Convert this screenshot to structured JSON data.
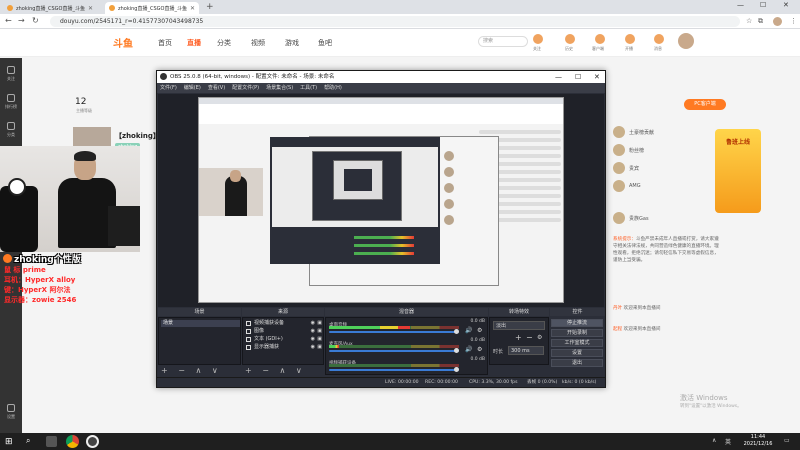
{
  "browser": {
    "tabs": [
      {
        "title": "zhoking直播_CSGO直播_斗鱼...",
        "active": false
      },
      {
        "title": "zhoking直播_CSGO直播_斗鱼...",
        "active": true
      }
    ],
    "new_tab": "+",
    "address": "douyu.com/2545171_r=0.41577307043498735",
    "window_controls": {
      "minimize": "—",
      "maximize": "☐",
      "close": "✕"
    }
  },
  "site": {
    "logo": "斗鱼",
    "nav": [
      "首页",
      "直播",
      "分类",
      "视频",
      "游戏",
      "鱼吧"
    ],
    "active_nav": "直播",
    "search_placeholder": "搜索",
    "header_icons": [
      {
        "label": "关注"
      },
      {
        "label": "历史"
      },
      {
        "label": "客户端"
      },
      {
        "label": "开播"
      },
      {
        "label": "消息"
      }
    ]
  },
  "room": {
    "fan_count": "12",
    "fan_label": "主播等级",
    "name": "【zhoking】",
    "tag": "zhoking",
    "left_nav": [
      "关注",
      "排行榜",
      "分类",
      "直播",
      "设置"
    ]
  },
  "overlay": {
    "name": "zhoking个性版",
    "lines": [
      "鼠 标 prime",
      "耳机：HyperX alloy",
      "键：HyperX 阿尔法",
      "显示器：zowie 2546"
    ]
  },
  "sidebar": {
    "rank_button": "PC客户端",
    "rows": [
      {
        "name": "土豪榜贡献"
      },
      {
        "name": "粉丝榜"
      },
      {
        "name": "贵宾"
      },
      {
        "name": "AMG"
      },
      {
        "name": "贵族Gas"
      }
    ],
    "banner_text": "鲁班上线",
    "notice_label": "系统提示：",
    "notice_body": "斗鱼严禁未成年人直播或打赏，请大家遵守相关法律法规，共同营造绿色健康的直播环境。理性观看，拒绝沉迷；请勿轻信私下交易等虚假信息，谨防上当受骗。",
    "messages": [
      {
        "user": "丹叶",
        "text": "欢迎来到本直播间"
      },
      {
        "user": "起程",
        "text": "欢迎来到本直播间"
      }
    ]
  },
  "obs": {
    "title": "OBS 25.0.8 (64-bit, windows) - 配置文件: 未命名 - 场景: 未命名",
    "menu": [
      "文件(F)",
      "编辑(E)",
      "查看(V)",
      "配置文件(P)",
      "场景集合(S)",
      "工具(T)",
      "帮助(H)"
    ],
    "docks": {
      "scenes": "场景",
      "sources": "来源",
      "mixer": "混音器",
      "transitions": "转场特效",
      "controls": "控件"
    },
    "scene_list": [
      "场景"
    ],
    "sources": [
      {
        "name": "视频捕获设备",
        "icon": "camera-icon"
      },
      {
        "name": "图像",
        "icon": "image-icon"
      },
      {
        "name": "文本 (GDI+)",
        "icon": "text-icon"
      },
      {
        "name": "显示器捕获",
        "icon": "monitor-icon"
      }
    ],
    "mixer": [
      {
        "name": "桌面音频",
        "db": "0.0 dB",
        "level": 0.62,
        "volume": 1.0
      },
      {
        "name": "麦克风/Aux",
        "db": "0.0 dB",
        "level": 0.08,
        "volume": 1.0
      },
      {
        "name": "视频捕获设备",
        "db": "0.0 dB",
        "level": 0.0,
        "volume": 1.0
      }
    ],
    "transition": {
      "type": "淡出",
      "duration_label": "时长",
      "duration": "300 ms"
    },
    "controls": [
      "停止推流",
      "开始录制",
      "工作室模式",
      "设置",
      "退出"
    ],
    "dock_tools": "+ − ∧ ∨",
    "status": {
      "dropped": "丢帧 0 (0.0%)",
      "live": "LIVE: 00:00:00",
      "rec": "REC: 00:00:00",
      "cpu": "CPU: 3.3%, 30.00 fps",
      "kbps": "kb/s: 0 (0 kb/s)"
    }
  },
  "activation": {
    "title": "激活 Windows",
    "subtitle": "转到\"设置\"以激活 Windows。"
  },
  "taskbar": {
    "start": "⊞",
    "tray": [
      "∧",
      "英"
    ],
    "time": "11:44",
    "date": "2021/12/16"
  }
}
